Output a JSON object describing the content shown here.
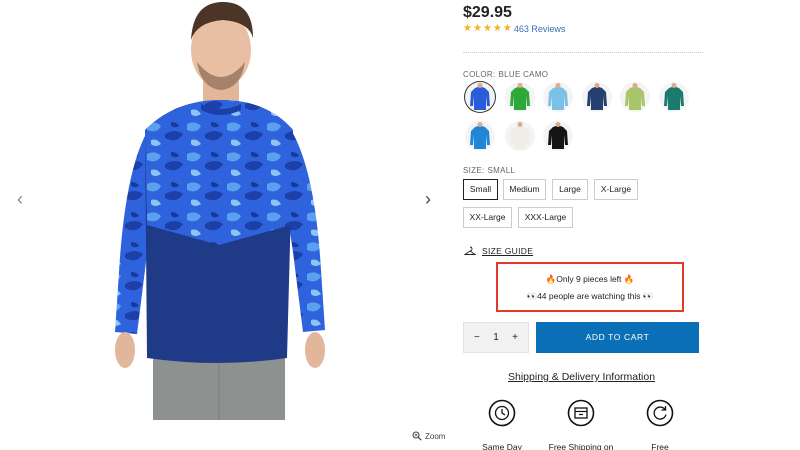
{
  "gallery": {
    "prev_arrow": "‹",
    "next_arrow": "›",
    "zoom_label": "Zoom"
  },
  "product": {
    "price": "$29.95",
    "rating_stars": 5,
    "reviews_label": "463 Reviews"
  },
  "color": {
    "label": "COLOR:",
    "selected": "BLUE CAMO",
    "swatches": [
      {
        "name": "blue-camo",
        "color": "#2b5bd6",
        "selected": true
      },
      {
        "name": "green",
        "color": "#2fa83a"
      },
      {
        "name": "light-blue-white",
        "color": "#7cc0e6"
      },
      {
        "name": "navy-camo",
        "color": "#24406e"
      },
      {
        "name": "grey-green",
        "color": "#a9c46a"
      },
      {
        "name": "teal",
        "color": "#1a7a6b"
      },
      {
        "name": "bright-blue",
        "color": "#1f86d8"
      },
      {
        "name": "white",
        "color": "#f0ece6"
      },
      {
        "name": "black",
        "color": "#151515"
      }
    ]
  },
  "size": {
    "label": "SIZE:",
    "selected": "SMALL",
    "options": [
      "Small",
      "Medium",
      "Large",
      "X-Large",
      "XX-Large",
      "XXX-Large"
    ]
  },
  "size_guide_label": "SIZE GUIDE",
  "scarcity": {
    "stock_line": "🔥Only 9 pieces left 🔥",
    "watching_line": "👀44 people are watching this 👀"
  },
  "cart": {
    "minus": "−",
    "quantity": "1",
    "plus": "+",
    "add_label": "ADD TO CART"
  },
  "shipping_link": "Shipping & Delivery Information",
  "features": [
    {
      "icon": "clock-icon",
      "label": "Same Day"
    },
    {
      "icon": "package-icon",
      "label": "Free Shipping on"
    },
    {
      "icon": "refresh-icon",
      "label": "Free"
    }
  ],
  "colors": {
    "accent": "#0a6fb7",
    "alert_border": "#e23b2a",
    "star": "#f2b41e",
    "link": "#3a6fb0"
  }
}
